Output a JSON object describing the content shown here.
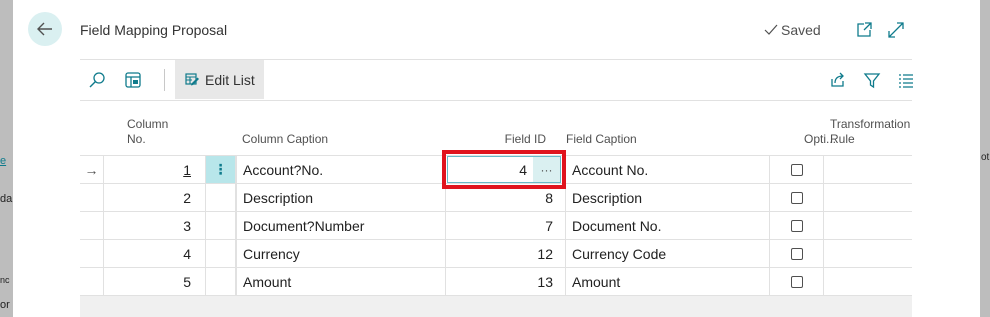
{
  "background": {
    "snippets": [
      "e",
      "da",
      "nc",
      "or",
      "ot"
    ]
  },
  "dialog": {
    "title": "Field Mapping Proposal",
    "status": "Saved",
    "icons": [
      "back-arrow-icon",
      "checkmark-icon",
      "open-new-window-icon",
      "expand-icon"
    ]
  },
  "toolbar": {
    "edit_list_label": "Edit List",
    "icons": [
      "search-icon",
      "filter-pane-icon",
      "edit-list-icon",
      "share-icon",
      "filter-icon",
      "list-view-icon"
    ]
  },
  "table": {
    "headers": {
      "column_no": "Column No.",
      "column_caption": "Column Caption",
      "field_id": "Field ID",
      "field_caption": "Field Caption",
      "optional": "Opti...",
      "transformation_rule_line1": "Transformation",
      "transformation_rule_line2": "Rule"
    },
    "rows": [
      {
        "column_no": "1",
        "column_caption": "Account?No.",
        "field_id": "4",
        "field_caption": "Account No.",
        "optional": false
      },
      {
        "column_no": "2",
        "column_caption": "Description",
        "field_id": "8",
        "field_caption": "Description",
        "optional": false
      },
      {
        "column_no": "3",
        "column_caption": "Document?Number",
        "field_id": "7",
        "field_caption": "Document No.",
        "optional": false
      },
      {
        "column_no": "4",
        "column_caption": "Currency",
        "field_id": "12",
        "field_caption": "Currency Code",
        "optional": false
      },
      {
        "column_no": "5",
        "column_caption": "Amount",
        "field_id": "13",
        "field_caption": "Amount",
        "optional": false
      }
    ],
    "selected_row_indicator": "→",
    "row_menu": "⋮",
    "lookup_button": "···"
  },
  "colors": {
    "accent": "#0f7b8c",
    "back_button_bg": "#daf0f1",
    "row_menu_bg": "#b8e6ea",
    "highlight_box": "#e0141e"
  }
}
